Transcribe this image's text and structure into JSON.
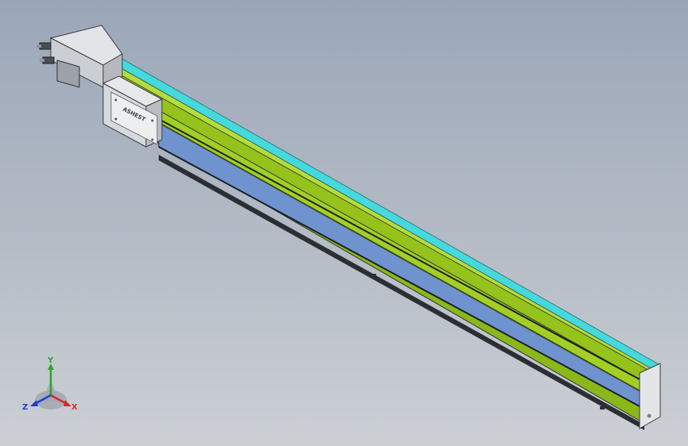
{
  "viewport": {
    "background_top": "#9aa6b8",
    "background_bottom": "#ccd0d5"
  },
  "model": {
    "rail_colors": {
      "top_strip": "#45d8dc",
      "green_upper": "#95c21b",
      "blue_cover": "#6f93cf",
      "green_lower": "#8ab81a",
      "dark_edge": "#2b2f33"
    },
    "carriage_logo": "ASHEST",
    "motor_label": "motor-housing"
  },
  "triad": {
    "x_label": "X",
    "y_label": "Y",
    "z_label": "Z",
    "x_color": "#d62a2a",
    "y_color": "#2aa52a",
    "z_color": "#2040d0"
  }
}
